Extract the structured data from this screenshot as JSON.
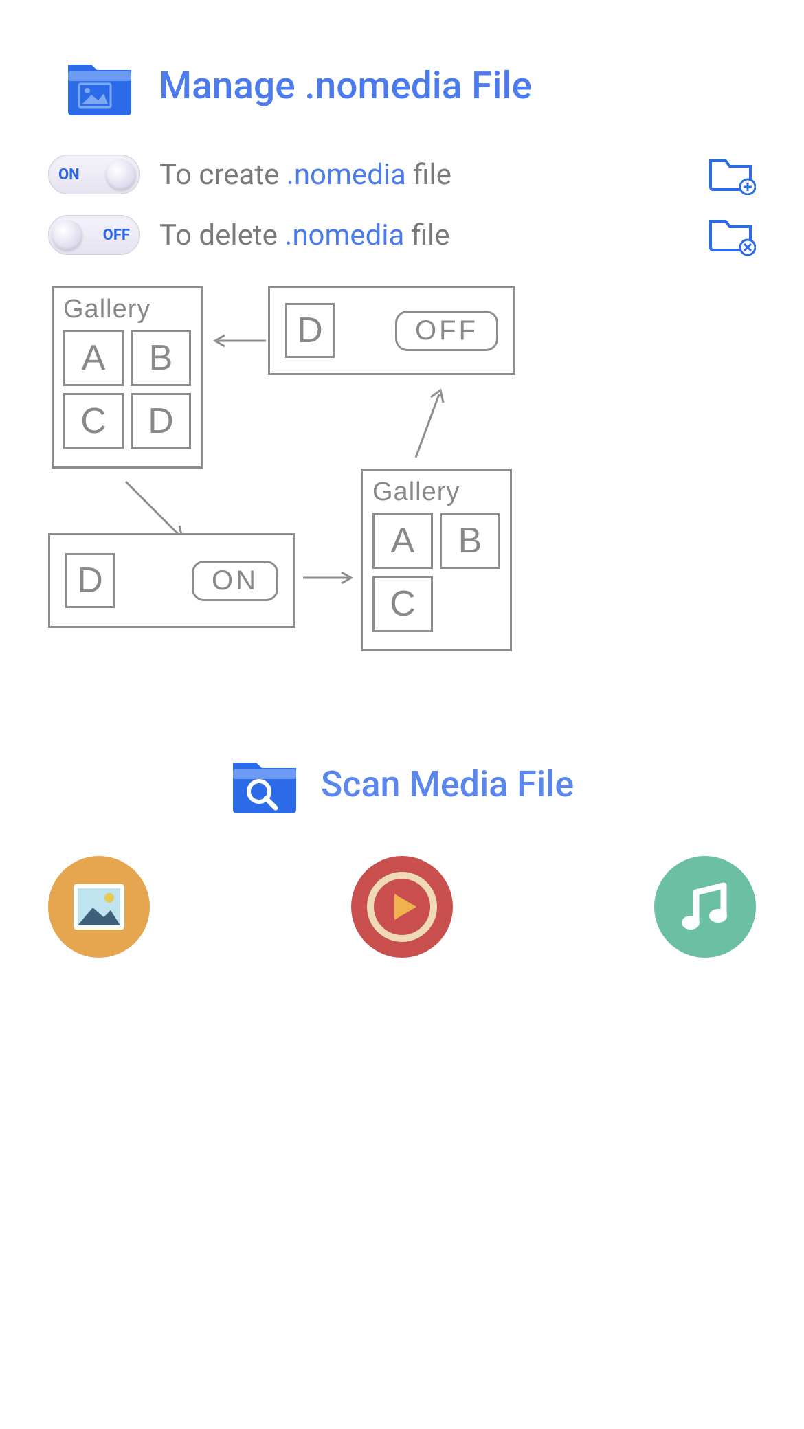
{
  "header": {
    "title": "Manage .nomedia File"
  },
  "toggles": {
    "on_row": {
      "state_label": "ON",
      "prefix": "To create ",
      "highlight": ".nomedia",
      "suffix": " file"
    },
    "off_row": {
      "state_label": "OFF",
      "prefix": "To delete ",
      "highlight": ".nomedia",
      "suffix": " file"
    }
  },
  "diagram": {
    "gallery_label": "Gallery",
    "cells_full": [
      "A",
      "B",
      "C",
      "D"
    ],
    "cells_reduced": [
      "A",
      "B",
      "C"
    ],
    "single_cell": "D",
    "on_label": "ON",
    "off_label": "OFF"
  },
  "scan": {
    "title": "Scan Media File"
  }
}
